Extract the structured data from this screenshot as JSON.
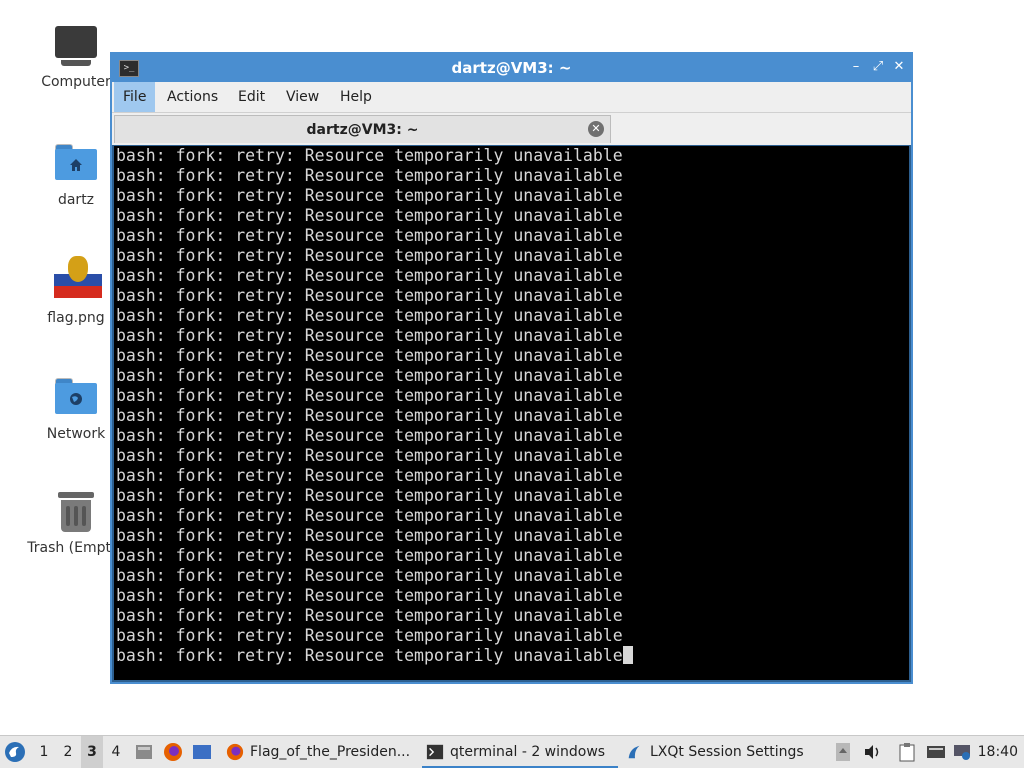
{
  "desktop": {
    "icons": [
      {
        "label": "Computer",
        "icon": "monitor-icon"
      },
      {
        "label": "dartz",
        "icon": "home-folder-icon"
      },
      {
        "label": "flag.png",
        "icon": "flag-image-icon"
      },
      {
        "label": "Network",
        "icon": "network-folder-icon"
      },
      {
        "label": "Trash (Empty)",
        "icon": "trash-icon"
      }
    ]
  },
  "window": {
    "title": "dartz@VM3: ~",
    "menu": [
      "File",
      "Actions",
      "Edit",
      "View",
      "Help"
    ],
    "active_menu": "File",
    "tab_title": "dartz@VM3: ~",
    "buttons": {
      "minimize": "–",
      "maximize": "⤢",
      "close": "✕"
    }
  },
  "terminal": {
    "lines": [
      "bash: fork: retry: Resource temporarily unavailable",
      "bash: fork: retry: Resource temporarily unavailable",
      "bash: fork: retry: Resource temporarily unavailable",
      "bash: fork: retry: Resource temporarily unavailable",
      "bash: fork: retry: Resource temporarily unavailable",
      "bash: fork: retry: Resource temporarily unavailable",
      "bash: fork: retry: Resource temporarily unavailable",
      "bash: fork: retry: Resource temporarily unavailable",
      "bash: fork: retry: Resource temporarily unavailable",
      "bash: fork: retry: Resource temporarily unavailable",
      "bash: fork: retry: Resource temporarily unavailable",
      "bash: fork: retry: Resource temporarily unavailable",
      "bash: fork: retry: Resource temporarily unavailable",
      "bash: fork: retry: Resource temporarily unavailable",
      "bash: fork: retry: Resource temporarily unavailable",
      "bash: fork: retry: Resource temporarily unavailable",
      "bash: fork: retry: Resource temporarily unavailable",
      "bash: fork: retry: Resource temporarily unavailable",
      "bash: fork: retry: Resource temporarily unavailable",
      "bash: fork: retry: Resource temporarily unavailable",
      "bash: fork: retry: Resource temporarily unavailable",
      "bash: fork: retry: Resource temporarily unavailable",
      "bash: fork: retry: Resource temporarily unavailable",
      "bash: fork: retry: Resource temporarily unavailable",
      "bash: fork: retry: Resource temporarily unavailable",
      "bash: fork: retry: Resource temporarily unavailable"
    ]
  },
  "taskbar": {
    "desktops": [
      "1",
      "2",
      "3",
      "4"
    ],
    "current_desktop": "3",
    "tasks": [
      {
        "label": "Flag_of_the_Presiden...",
        "icon": "firefox-icon"
      },
      {
        "label": "qterminal - 2 windows",
        "icon": "terminal-icon",
        "active": true
      },
      {
        "label": "LXQt Session Settings",
        "icon": "lxqt-settings-icon"
      }
    ],
    "clock": "18:40"
  },
  "colors": {
    "title_bar": "#4a8ed0",
    "terminal_bg": "#000000",
    "terminal_fg": "#d8d8d8",
    "folder": "#4d9be0"
  }
}
